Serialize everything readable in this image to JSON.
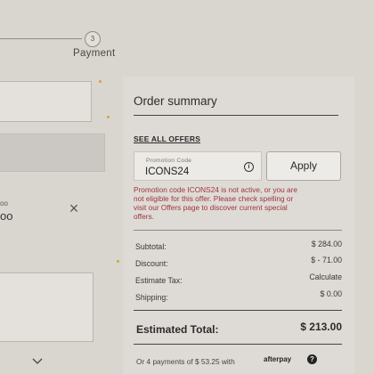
{
  "stepper": {
    "step_number": "3",
    "step_label": "Payment"
  },
  "left": {
    "small_text": "oo",
    "big_text": "oo",
    "close_symbol": "×"
  },
  "summary": {
    "title": "Order summary",
    "see_all_offers": "SEE ALL OFFERS",
    "promo": {
      "caption": "Promotion Code",
      "value": "ICONS24",
      "apply_label": "Apply",
      "error_lines": [
        "Promotion code ICONS24 is not active, or you are",
        "not eligible for this offer. Please check spelling or",
        "visit our Offers page to discover current special",
        "offers."
      ]
    },
    "rows": [
      {
        "label": "Subtotal:",
        "value": "$ 284.00"
      },
      {
        "label": "Discount:",
        "value": "$ - 71.00"
      },
      {
        "label": "Estimate Tax:",
        "value": "Calculate"
      },
      {
        "label": "Shipping:",
        "value": "$ 0.00"
      }
    ],
    "total_label": "Estimated Total:",
    "total_value": "$ 213.00",
    "installments_text": "Or 4 payments of $ 53.25 with",
    "afterpay_label": "afterpay",
    "help_symbol": "?"
  },
  "icons": [
    "info-icon",
    "close-icon",
    "chevron-down-icon",
    "help-icon"
  ],
  "colors": {
    "error": "#a0353e",
    "background": "#d9d6d0",
    "panel": "#dedbd6"
  }
}
